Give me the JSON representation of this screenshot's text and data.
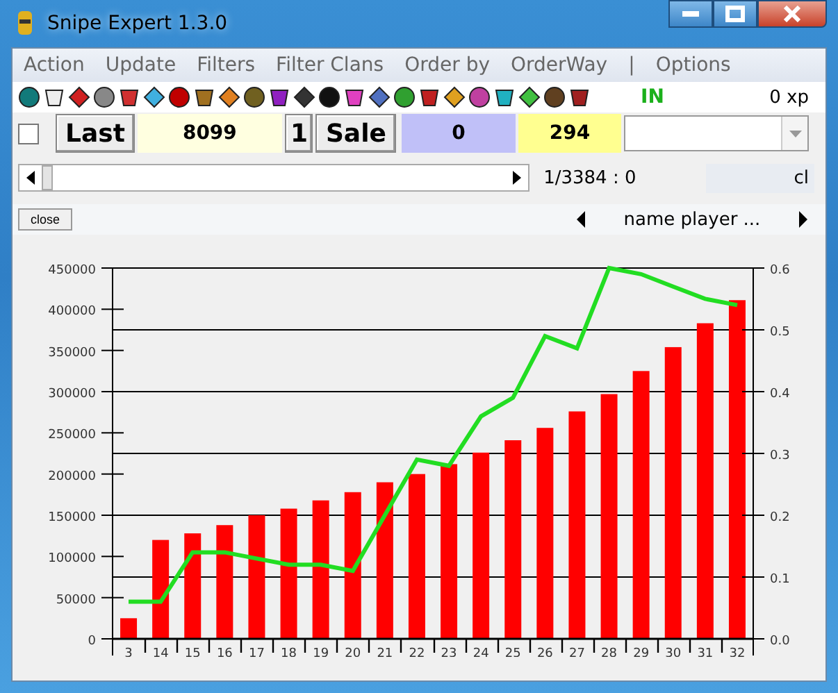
{
  "window": {
    "title": "Snipe Expert 1.3.0"
  },
  "menu": [
    "Action",
    "Update",
    "Filters",
    "Filter Clans",
    "Order by",
    "OrderWay",
    "|",
    "Options"
  ],
  "status": {
    "state": "IN",
    "xp": "0 xp"
  },
  "toolbar": {
    "checked": false,
    "last_button": "Last",
    "last_value": "8099",
    "count_button": "1",
    "sale_button": "Sale",
    "field_blue": "0",
    "field_yellow": "294"
  },
  "scroll_row": {
    "position": "1/3384 : 0",
    "label": "cl"
  },
  "panel": {
    "close_button": "close",
    "column_header": "name player ..."
  },
  "chart": {
    "chart_data": {
      "type": "bar",
      "categories": [
        "3",
        "14",
        "15",
        "16",
        "17",
        "18",
        "19",
        "20",
        "21",
        "22",
        "23",
        "24",
        "25",
        "26",
        "27",
        "28",
        "29",
        "30",
        "31",
        "32"
      ],
      "grid": true,
      "series": [
        {
          "type": "bar",
          "color": "#ff0000",
          "values": [
            25000,
            120000,
            128000,
            138000,
            150000,
            158000,
            168000,
            178000,
            190000,
            200000,
            212000,
            226000,
            241000,
            256000,
            276000,
            297000,
            325000,
            354000,
            383000,
            411000
          ]
        },
        {
          "type": "line",
          "axis": "y2",
          "color": "#22dd22",
          "values": [
            0.06,
            0.06,
            0.14,
            0.14,
            0.13,
            0.12,
            0.12,
            0.11,
            0.2,
            0.29,
            0.28,
            0.36,
            0.39,
            0.49,
            0.47,
            0.6,
            0.59,
            0.57,
            0.55,
            0.54
          ]
        }
      ],
      "ylim": [
        0,
        450000
      ],
      "yticks": [
        0,
        50000,
        100000,
        150000,
        200000,
        250000,
        300000,
        350000,
        400000,
        450000
      ],
      "y2lim": [
        0,
        0.6
      ],
      "y2ticks": [
        {
          "value": 0,
          "label": "0.0"
        },
        {
          "value": 0.1,
          "label": "0.1"
        },
        {
          "value": 0.2,
          "label": "0.2"
        },
        {
          "value": 0.3,
          "label": "0.3"
        },
        {
          "value": 0.4,
          "label": "0.4"
        },
        {
          "value": 0.5,
          "label": "0.5"
        },
        {
          "value": 0.6,
          "label": "0.6"
        }
      ]
    }
  }
}
